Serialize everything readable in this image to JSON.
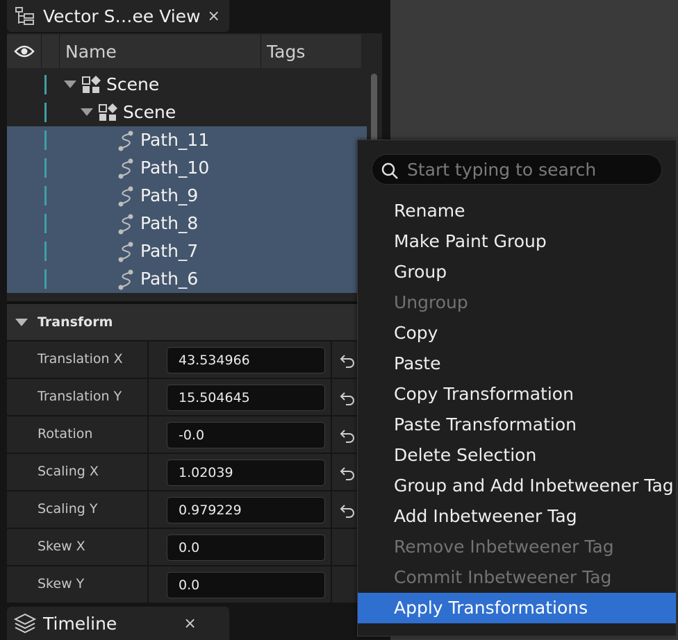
{
  "scene_tab": {
    "title": "Vector S…ee View",
    "close": "×",
    "icon": "tree-hierarchy-icon"
  },
  "outliner": {
    "columns": {
      "visibility_icon": "eye-icon",
      "name": "Name",
      "tags": "Tags"
    },
    "rows": [
      {
        "label": "Scene",
        "icon": "scene-icon",
        "expanded": true,
        "selected": false
      },
      {
        "label": "Scene",
        "icon": "scene-icon",
        "expanded": true,
        "selected": false
      },
      {
        "label": "Path_11",
        "icon": "path-icon",
        "selected": true
      },
      {
        "label": "Path_10",
        "icon": "path-icon",
        "selected": true
      },
      {
        "label": "Path_9",
        "icon": "path-icon",
        "selected": true
      },
      {
        "label": "Path_8",
        "icon": "path-icon",
        "selected": true
      },
      {
        "label": "Path_7",
        "icon": "path-icon",
        "selected": true
      },
      {
        "label": "Path_6",
        "icon": "path-icon",
        "selected": true
      }
    ]
  },
  "details": {
    "section_title": "Transform",
    "properties": [
      {
        "label": "Translation X",
        "value": "43.534966",
        "has_reset": true
      },
      {
        "label": "Translation Y",
        "value": "15.504645",
        "has_reset": true
      },
      {
        "label": "Rotation",
        "value": "-0.0",
        "has_reset": true
      },
      {
        "label": "Scaling X",
        "value": "1.02039",
        "has_reset": true
      },
      {
        "label": "Scaling Y",
        "value": "0.979229",
        "has_reset": true
      },
      {
        "label": "Skew X",
        "value": "0.0",
        "has_reset": false
      },
      {
        "label": "Skew Y",
        "value": "0.0",
        "has_reset": false
      }
    ]
  },
  "timeline_tab": {
    "title": "Timeline",
    "close": "×",
    "icon": "layers-icon"
  },
  "context_menu": {
    "search_placeholder": "Start typing to search",
    "items": [
      {
        "label": "Rename",
        "enabled": true
      },
      {
        "label": "Make Paint Group",
        "enabled": true
      },
      {
        "label": "Group",
        "enabled": true
      },
      {
        "label": "Ungroup",
        "enabled": false
      },
      {
        "label": "Copy",
        "enabled": true
      },
      {
        "label": "Paste",
        "enabled": true
      },
      {
        "label": "Copy Transformation",
        "enabled": true
      },
      {
        "label": "Paste Transformation",
        "enabled": true
      },
      {
        "label": "Delete Selection",
        "enabled": true
      },
      {
        "label": "Group and Add Inbetweener Tag",
        "enabled": true
      },
      {
        "label": "Add Inbetweener Tag",
        "enabled": true
      },
      {
        "label": "Remove Inbetweener Tag",
        "enabled": false
      },
      {
        "label": "Commit Inbetweener Tag",
        "enabled": false
      },
      {
        "label": "Apply Transformations",
        "enabled": true,
        "highlighted": true
      }
    ]
  },
  "colors": {
    "selection": "#44566d",
    "highlight": "#2f6fd0",
    "indent_bar": "#3fa0a8"
  }
}
